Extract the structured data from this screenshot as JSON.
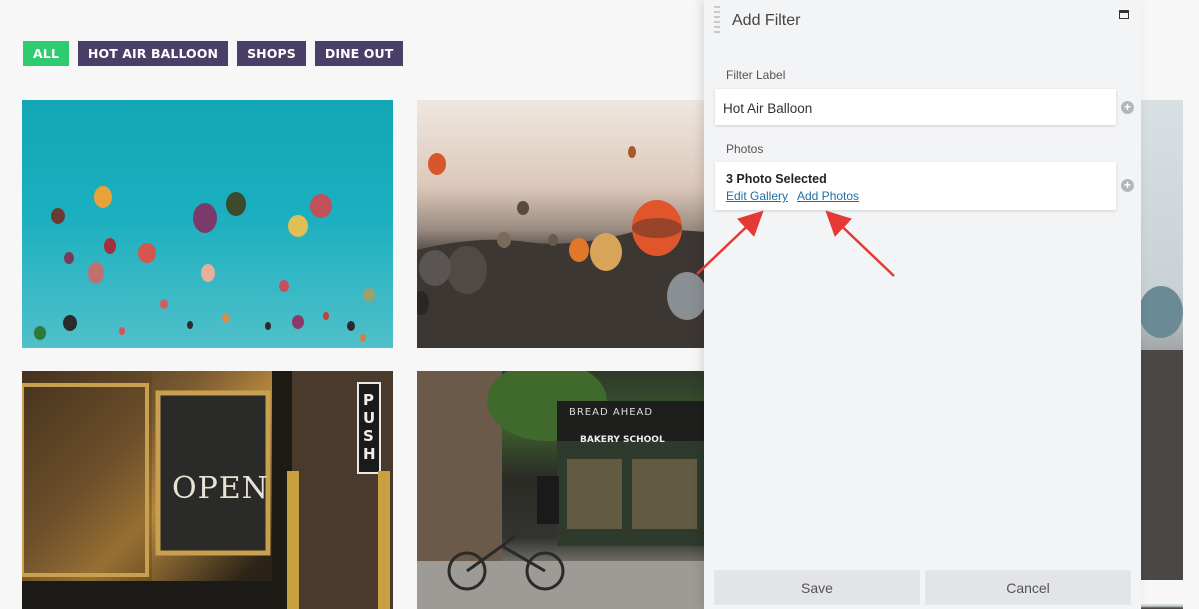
{
  "filters": [
    {
      "label": "ALL",
      "active": true
    },
    {
      "label": "HOT AIR BALLOON",
      "active": false
    },
    {
      "label": "SHOPS",
      "active": false
    },
    {
      "label": "DINE OUT",
      "active": false
    }
  ],
  "gallery": {
    "tiles": [
      {
        "name": "balloons-blue-sky"
      },
      {
        "name": "balloons-dusk-valley"
      },
      {
        "name": "storefront-open-sign"
      },
      {
        "name": "bakery-storefront"
      },
      {
        "name": "balloons-rocky-landscape"
      }
    ],
    "shop_signs": {
      "push": "PUSH",
      "open": "OPEN",
      "bakery_name": "BREAD AHEAD",
      "bakery_school": "BAKERY SCHOOL"
    }
  },
  "panel": {
    "title": "Add Filter",
    "filter_label_caption": "Filter Label",
    "filter_label_value": "Hot Air Balloon",
    "photos_caption": "Photos",
    "photos_selected": "3 Photo Selected",
    "edit_gallery": "Edit Gallery",
    "add_photos": "Add Photos",
    "save": "Save",
    "cancel": "Cancel"
  },
  "colors": {
    "filter_active": "#2ecc71",
    "filter_inactive": "#4a3f66",
    "link": "#1f6fa3",
    "arrow": "#e53935"
  }
}
